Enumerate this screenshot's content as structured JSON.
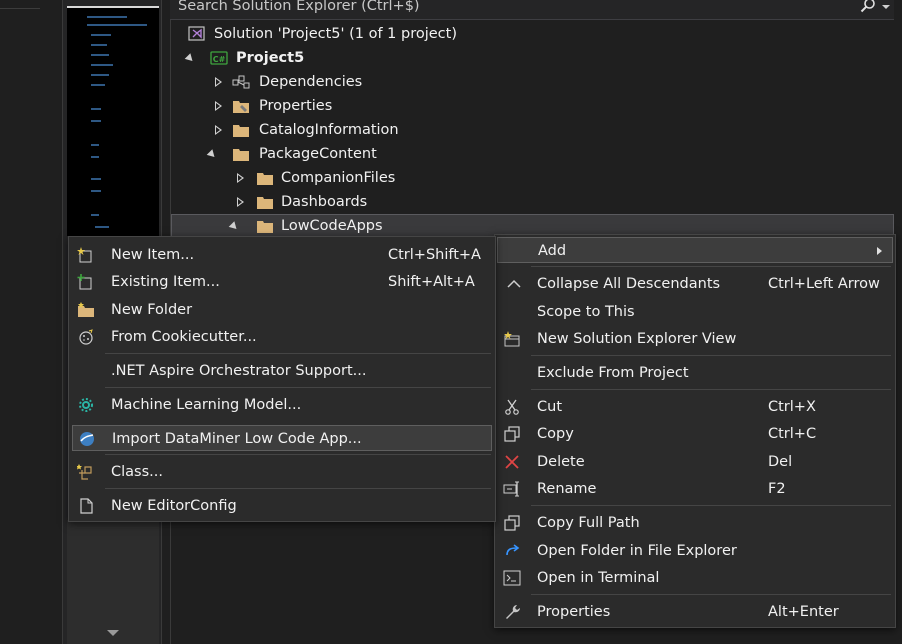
{
  "search": {
    "placeholder": "Search Solution Explorer (Ctrl+$)"
  },
  "tree": {
    "solution": "Solution 'Project5' (1 of 1 project)",
    "project": "Project5",
    "project_badge": "C#",
    "items": {
      "dependencies": "Dependencies",
      "properties": "Properties",
      "catalog": "CatalogInformation",
      "package": "PackageContent",
      "companion": "CompanionFiles",
      "dashboards": "Dashboards",
      "lowcode": "LowCodeApps"
    }
  },
  "add_menu": {
    "new_item": {
      "label": "New Item...",
      "shortcut": "Ctrl+Shift+A"
    },
    "existing_item": {
      "label": "Existing Item...",
      "shortcut": "Shift+Alt+A"
    },
    "new_folder": {
      "label": "New Folder"
    },
    "cookiecutter": {
      "label": "From Cookiecutter..."
    },
    "aspire": {
      "label": ".NET Aspire Orchestrator Support..."
    },
    "ml_model": {
      "label": "Machine Learning Model..."
    },
    "import_dm": {
      "label": "Import DataMiner Low Code App..."
    },
    "class": {
      "label": "Class..."
    },
    "editorconfig": {
      "label": "New EditorConfig"
    }
  },
  "context_menu": {
    "add": {
      "label": "Add"
    },
    "collapse": {
      "label": "Collapse All Descendants",
      "shortcut": "Ctrl+Left Arrow"
    },
    "scope": {
      "label": "Scope to This"
    },
    "new_view": {
      "label": "New Solution Explorer View"
    },
    "exclude": {
      "label": "Exclude From Project"
    },
    "cut": {
      "label": "Cut",
      "shortcut": "Ctrl+X"
    },
    "copy": {
      "label": "Copy",
      "shortcut": "Ctrl+C"
    },
    "delete": {
      "label": "Delete",
      "shortcut": "Del"
    },
    "rename": {
      "label": "Rename",
      "shortcut": "F2"
    },
    "copy_path": {
      "label": "Copy Full Path"
    },
    "open_explorer": {
      "label": "Open Folder in File Explorer"
    },
    "open_terminal": {
      "label": "Open in Terminal"
    },
    "properties": {
      "label": "Properties",
      "shortcut": "Alt+Enter"
    }
  },
  "colors": {
    "folder": "#dcb67a",
    "accent_blue": "#3794ff",
    "delete_red": "#e04545",
    "csharp_green": "#3fa53f"
  }
}
